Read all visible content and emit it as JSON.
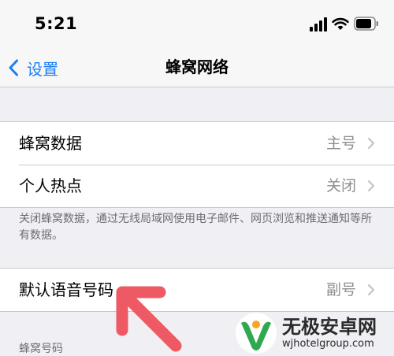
{
  "status_bar": {
    "time": "5:21"
  },
  "nav": {
    "back_label": "设置",
    "title": "蜂窝网络"
  },
  "group1": {
    "rows": [
      {
        "label": "蜂窝数据",
        "value": "主号"
      },
      {
        "label": "个人热点",
        "value": "关闭"
      }
    ],
    "footer": "关闭蜂窝数据，通过无线局域网使用电子邮件、网页浏览和推送通知等所有数据。"
  },
  "group2": {
    "rows": [
      {
        "label": "默认语音号码",
        "value": "副号"
      }
    ]
  },
  "section_header": "蜂窝号码",
  "watermark": {
    "title": "无极安卓网",
    "url": "wjhotelgroup.com"
  },
  "colors": {
    "accent": "#1c7ef5",
    "annotation_arrow": "#ee5a63",
    "background": "#efeff4"
  },
  "icons": [
    "signal-icon",
    "wifi-icon",
    "battery-icon",
    "chevron-left-icon",
    "chevron-right-icon"
  ]
}
